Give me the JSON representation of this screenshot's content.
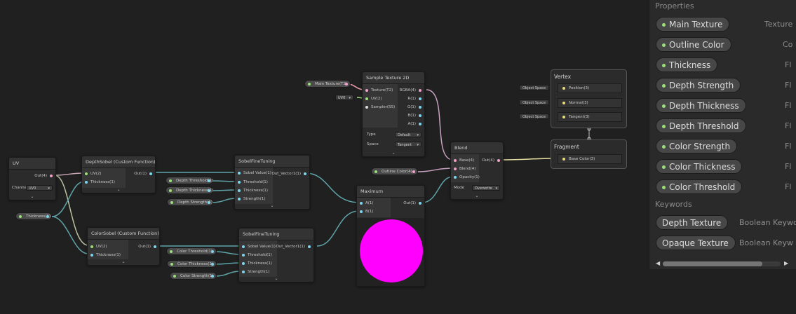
{
  "nodes": {
    "uv": {
      "title": "UV",
      "out": "Out(4)",
      "channel_label": "Channel",
      "channel_value": "UV0"
    },
    "depth_sobel": {
      "title": "DepthSobel (Custom Function)",
      "in1": "UV(2)",
      "in2": "Thickness(1)",
      "out": "Out(1)"
    },
    "depth_fine": {
      "title": "SobelFineTuning",
      "in1": "Sobel Value(1)",
      "in2": "Threshold(1)",
      "in3": "Thickness(1)",
      "in4": "Strength(1)",
      "out": "Out_Vector1(1)"
    },
    "color_sobel": {
      "title": "ColorSobel (Custom Function)",
      "in1": "UV(2)",
      "in2": "Thickness(1)",
      "out": "Out(1)"
    },
    "color_fine": {
      "title": "SobelFineTuning",
      "in1": "Sobel Value(1)",
      "in2": "Threshold(1)",
      "in3": "Thickness(1)",
      "in4": "Strength(1)",
      "out": "Out_Vector1(1)"
    },
    "sample": {
      "title": "Sample Texture 2D",
      "in1": "Texture(T2)",
      "in2": "UV(2)",
      "in3": "Sampler(SS)",
      "out1": "RGBA(4)",
      "out2": "R(1)",
      "out3": "G(1)",
      "out4": "B(1)",
      "out5": "A(1)",
      "type_label": "Type",
      "type_value": "Default",
      "space_label": "Space",
      "space_value": "Tangent",
      "uv_field": "UV0"
    },
    "maximum": {
      "title": "Maximum",
      "in1": "A(1)",
      "in2": "B(1)",
      "out": "Out(1)",
      "preview_color": "#ff00ff"
    },
    "blend": {
      "title": "Blend",
      "in1": "Base(4)",
      "in2": "Blend(4)",
      "in3": "Opacity(1)",
      "out": "Out(4)",
      "mode_label": "Mode",
      "mode_value": "Overwrite"
    }
  },
  "properties_pills": {
    "thickness": "Thickness(1)",
    "depth_threshold": "Depth Threshold(1)",
    "depth_thickness": "Depth Thickness(1)",
    "depth_strength": "Depth Strength(1)",
    "color_threshold": "Color Threshold(1)",
    "color_thickness": "Color Thickness(1)",
    "color_strength": "Color Strength(1)",
    "main_texture": "Main Texture(T2)",
    "outline_color": "Outline Color(4)"
  },
  "vertex": {
    "title": "Vertex",
    "rows": [
      "Position(3)",
      "Normal(3)",
      "Tangent(3)"
    ],
    "space": "Object Space"
  },
  "fragment": {
    "title": "Fragment",
    "rows": [
      "Base Color(3)"
    ]
  },
  "blackboard": {
    "properties_header": "Properties",
    "keywords_header": "Keywords",
    "properties": [
      {
        "name": "Main Texture",
        "type": "Texture"
      },
      {
        "name": "Outline Color",
        "type": "Co"
      },
      {
        "name": "Thickness",
        "type": "Fl"
      },
      {
        "name": "Depth Strength",
        "type": "Fl"
      },
      {
        "name": "Depth Thickness",
        "type": "Fl"
      },
      {
        "name": "Depth Threshold",
        "type": "Fl"
      },
      {
        "name": "Color Strength",
        "type": "Fl"
      },
      {
        "name": "Color Thickness",
        "type": "Fl"
      },
      {
        "name": "Color Threshold",
        "type": "Fl"
      }
    ],
    "keywords": [
      {
        "name": "Depth Texture",
        "type": "Boolean Keywo"
      },
      {
        "name": "Opaque Texture",
        "type": "Boolean Keyw"
      }
    ]
  },
  "colors": {
    "pink_port": "#f3a0c8",
    "cyan_port": "#7fd7ee",
    "green_port": "#9be07a",
    "yellow_port": "#e9df7a",
    "background": "#202020"
  }
}
